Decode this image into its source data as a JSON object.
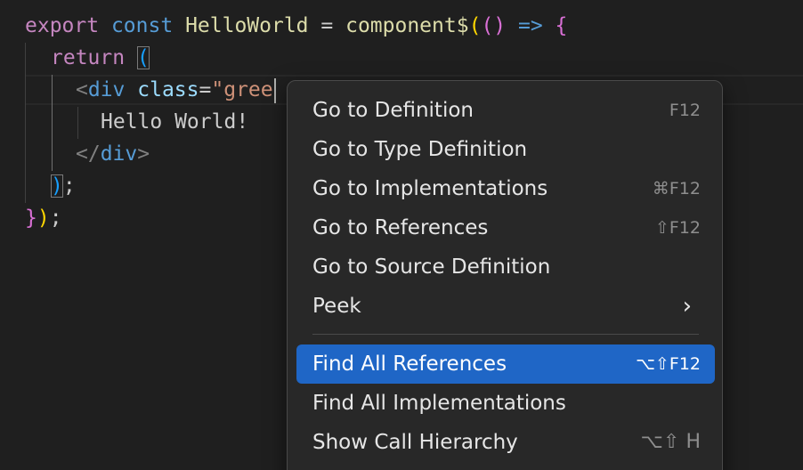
{
  "editor": {
    "line1": {
      "kw_export": "export",
      "kw_const": "const",
      "name": "HelloWorld",
      "eq": " = ",
      "fn": "component$",
      "paren_open": "(",
      "params": "()",
      "arrow": " => ",
      "brace": "{"
    },
    "line2": {
      "kw_return": "return",
      "paren": "("
    },
    "line3": {
      "lt": "<",
      "tag": "div",
      "attr": "class",
      "eq": "=",
      "str": "\"gree"
    },
    "line4": {
      "text": "Hello World!"
    },
    "line5": {
      "lt": "</",
      "tag": "div",
      "gt": ">"
    },
    "line6": {
      "paren": ")",
      "semi": ";"
    },
    "line7": {
      "brace": "}",
      "paren": ")",
      "semi": ";"
    }
  },
  "context_menu": {
    "items": [
      {
        "label": "Go to Definition",
        "shortcut": "F12"
      },
      {
        "label": "Go to Type Definition",
        "shortcut": ""
      },
      {
        "label": "Go to Implementations",
        "shortcut": "⌘F12"
      },
      {
        "label": "Go to References",
        "shortcut": "⇧F12"
      },
      {
        "label": "Go to Source Definition",
        "shortcut": ""
      },
      {
        "label": "Peek",
        "shortcut": ""
      },
      {
        "label": "Find All References",
        "shortcut": "⌥⇧F12"
      },
      {
        "label": "Find All Implementations",
        "shortcut": ""
      },
      {
        "label": "Show Call Hierarchy",
        "shortcut": "⌥⇧ H"
      }
    ],
    "submenu_icon": "chevron-right-icon",
    "chevron_glyph": "›",
    "selected_index": 6
  },
  "colors": {
    "background": "#1f1f1f",
    "menu_background": "#282828",
    "selection": "#1f66c6"
  }
}
